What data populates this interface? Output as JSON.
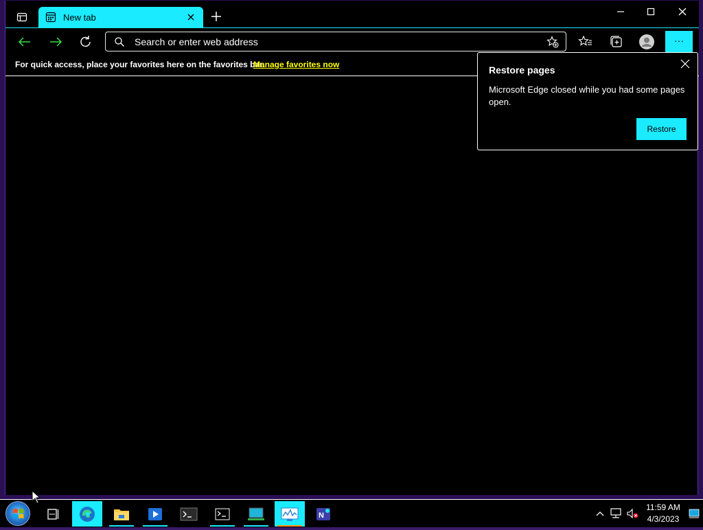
{
  "browser": {
    "tab": {
      "title": "New tab"
    },
    "address_bar": {
      "placeholder": "Search or enter web address"
    },
    "more_label": "···"
  },
  "favorites_bar": {
    "message": "For quick access, place your favorites here on the favorites bar.",
    "link": "Manage favorites now"
  },
  "restore_popup": {
    "title": "Restore pages",
    "body": "Microsoft Edge closed while you had some pages open.",
    "button": "Restore"
  },
  "taskbar": {
    "time": "11:59 AM",
    "date": "4/3/2023",
    "apps": [
      "task-view",
      "edge",
      "file-explorer",
      "media-player",
      "terminal",
      "command-prompt",
      "laptop",
      "performance-monitor",
      "network-app"
    ]
  },
  "colors": {
    "accent": "#1aebff",
    "link": "#ffff00",
    "background": "#000000"
  }
}
